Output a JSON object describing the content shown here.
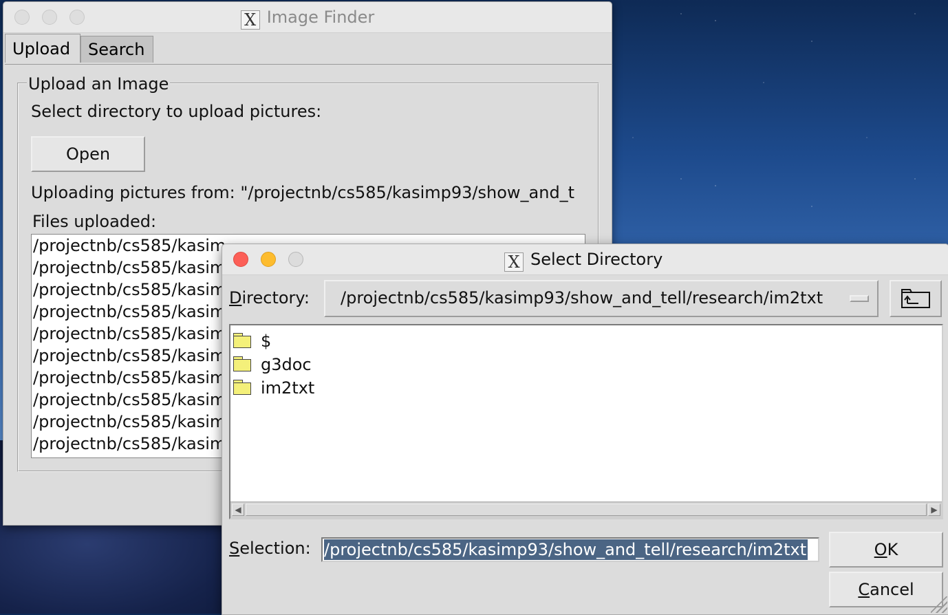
{
  "finder": {
    "title": "Image Finder",
    "tabs": [
      "Upload",
      "Search"
    ],
    "group_title": "Upload an Image",
    "select_prompt": "Select directory to upload pictures:",
    "open_label": "Open",
    "uploading_from": "Uploading pictures from: \"/projectnb/cs585/kasimp93/show_and_t",
    "files_uploaded_label": "Files uploaded:",
    "files": [
      "/projectnb/cs585/kasim",
      "/projectnb/cs585/kasim",
      "/projectnb/cs585/kasim",
      "/projectnb/cs585/kasim",
      "/projectnb/cs585/kasim",
      "/projectnb/cs585/kasim",
      "/projectnb/cs585/kasim",
      "/projectnb/cs585/kasim",
      "/projectnb/cs585/kasim",
      "/projectnb/cs585/kasim"
    ]
  },
  "dialog": {
    "title": "Select Directory",
    "directory_label_u": "D",
    "directory_label_rest": "irectory:",
    "directory_value": "/projectnb/cs585/kasimp93/show_and_tell/research/im2txt",
    "folders": [
      "$",
      "g3doc",
      "im2txt"
    ],
    "selection_label_u": "S",
    "selection_label_rest": "election:",
    "selection_value": "/projectnb/cs585/kasimp93/show_and_tell/research/im2txt",
    "ok_u": "O",
    "ok_rest": "K",
    "cancel_u": "C",
    "cancel_rest": "ancel"
  }
}
